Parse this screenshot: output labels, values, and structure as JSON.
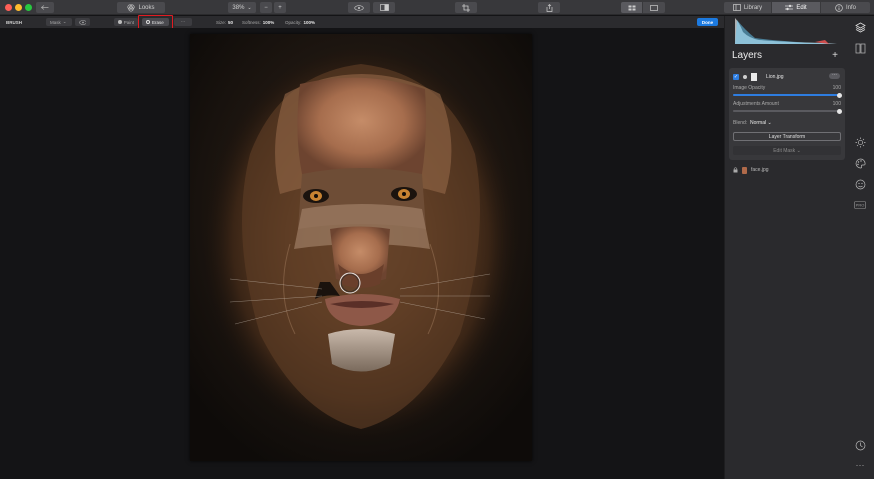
{
  "titlebar": {
    "looks_label": "Looks",
    "zoom_value": "38%",
    "tabs": [
      {
        "label": "Library",
        "active": false
      },
      {
        "label": "Edit",
        "active": true
      },
      {
        "label": "Info",
        "active": false
      }
    ]
  },
  "toolbar": {
    "mode_label": "BRUSH",
    "mask_label": "Mask",
    "paint_label": "Paint",
    "erase_label": "Erase",
    "size_label": "Size:",
    "size_value": "50",
    "softness_label": "Softness:",
    "softness_value": "100%",
    "opacity_label": "Opacity:",
    "opacity_value": "100%",
    "done_label": "Done"
  },
  "layers_panel": {
    "title": "Layers",
    "active_layer": {
      "name": "Lion.jpg",
      "checked": true,
      "image_opacity_label": "Image Opacity",
      "image_opacity_value": "100",
      "image_opacity_level": 1.0,
      "adjustments_label": "Adjustments Amount",
      "adjustments_value": "100",
      "adjustments_level": 1.0,
      "blend_label": "Blend:",
      "blend_value": "Normal",
      "transform_label": "Layer Transform",
      "edit_mask_label": "Edit Mask"
    },
    "base_layer": {
      "name": "face.jpg"
    }
  },
  "colors": {
    "accent": "#1c7ae0",
    "highlight_box": "#e11b22"
  },
  "icons": [
    "layers-icon",
    "compare-icon",
    "sun-icon",
    "palette-icon",
    "face-icon",
    "pro-icon",
    "history-icon",
    "more-icon"
  ]
}
